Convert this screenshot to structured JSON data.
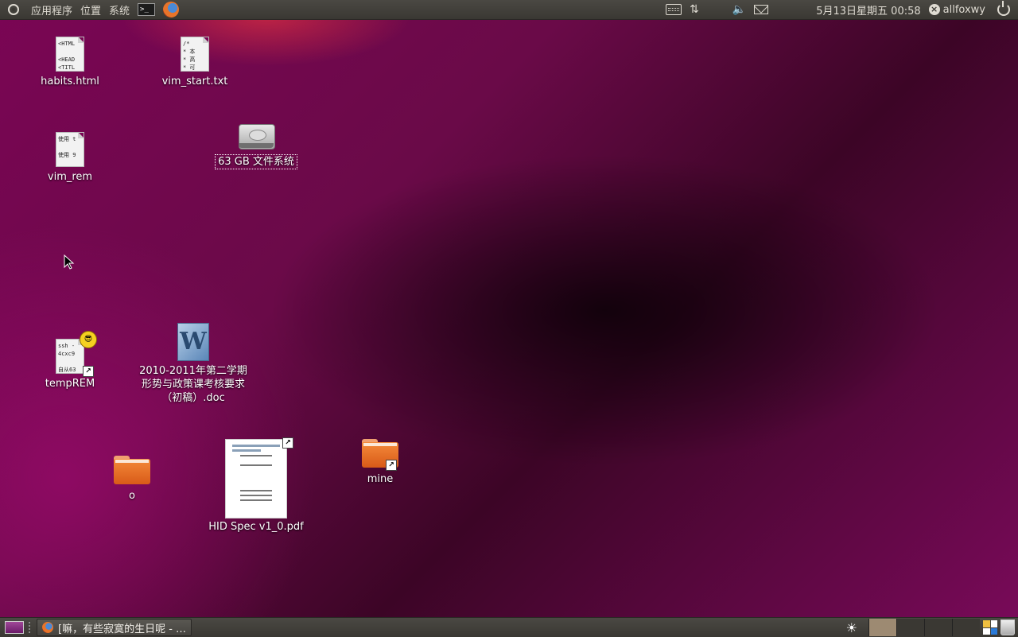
{
  "top_panel": {
    "menu_applications": "应用程序",
    "menu_places": "位置",
    "menu_system": "系统",
    "terminal_glyph": ">_",
    "datetime": "5月13日星期五 00:58",
    "username": "allfoxwy",
    "volume_glyph": "🔈",
    "network_glyph": "⇅"
  },
  "desktop": {
    "icons": [
      {
        "label": "habits.html",
        "preview": [
          "<HTML",
          "",
          "<HEAD",
          "<TITL"
        ]
      },
      {
        "label": "vim_start.txt",
        "preview": [
          "/*",
          " * 本",
          " * 高",
          " * 可"
        ]
      },
      {
        "label": "vim_rem",
        "preview": [
          "使用 t",
          "",
          "使用 9"
        ]
      },
      {
        "label": "63 GB 文件系统"
      },
      {
        "label": "tempREM",
        "preview": [
          "ssh -",
          "4cxc9",
          "",
          "自从63"
        ]
      },
      {
        "label_lines": [
          "2010-2011年第二学期",
          "形势与政策课考核要求",
          "（初稿）.doc"
        ],
        "glyph": "W"
      },
      {
        "label": "o"
      },
      {
        "label": "HID Spec v1_0.pdf"
      },
      {
        "label": "mine"
      }
    ]
  },
  "bottom_panel": {
    "task_title": "[嘛，有些寂寞的生日呢 - …",
    "sun_glyph": "☀"
  },
  "colors": {
    "panel": "#3c3b37",
    "panel_text": "#dfdbd2",
    "wallpaper": "#7a0554",
    "folder": "#e8742a"
  }
}
